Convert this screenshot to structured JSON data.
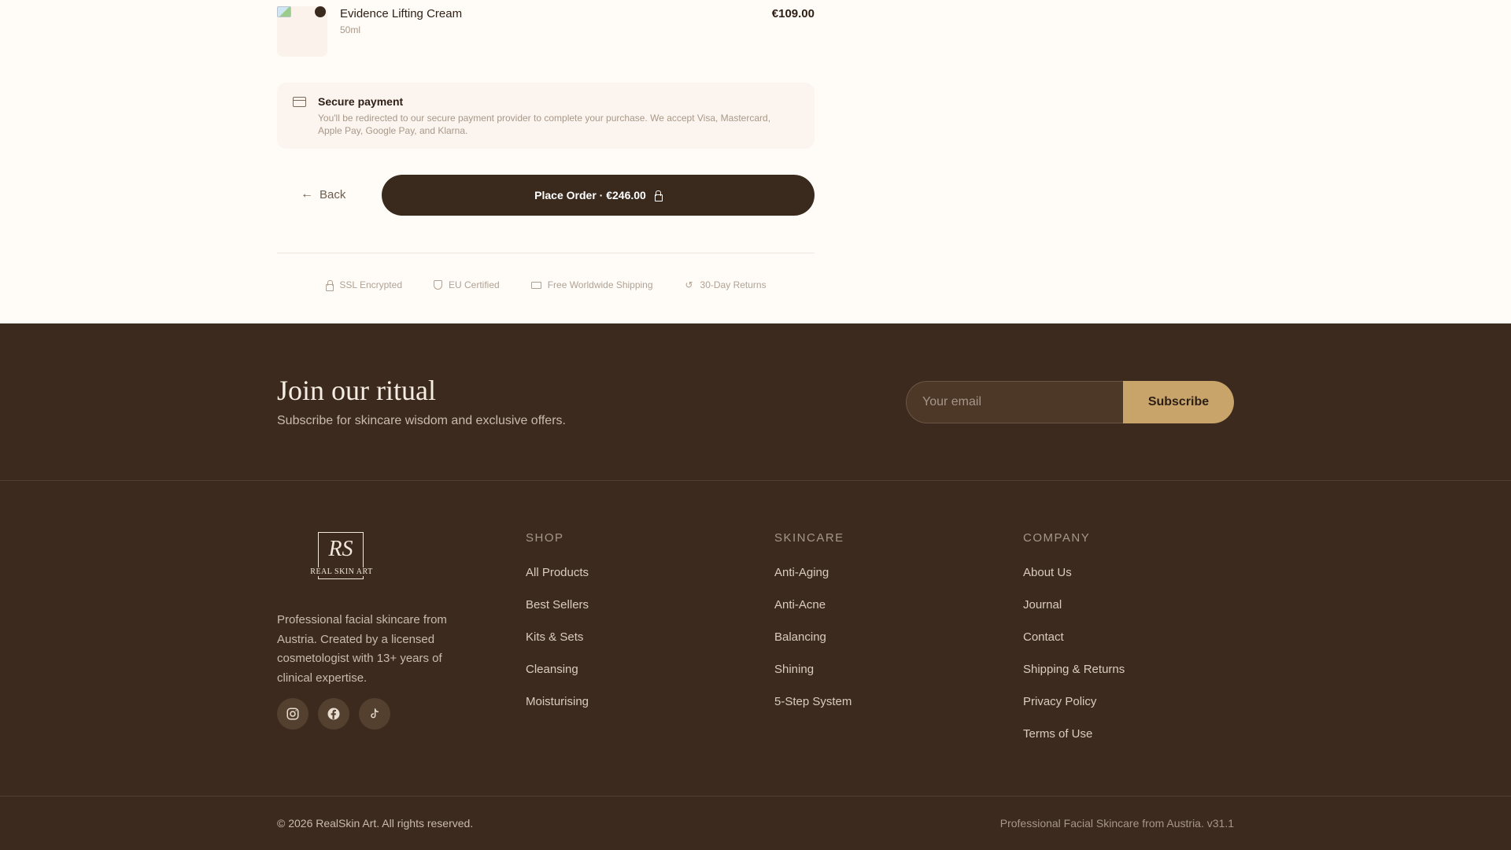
{
  "order_item": {
    "name": "Evidence Lifting Cream",
    "size": "50ml",
    "price": "€109.00"
  },
  "payment": {
    "title": "Secure payment",
    "text": "You'll be redirected to our secure payment provider to complete your purchase. We accept Visa, Mastercard, Apple Pay, Google Pay, and Klarna."
  },
  "actions": {
    "back_label": "Back",
    "place_order_label": "Place Order · €246.00"
  },
  "trust": [
    {
      "label": "SSL Encrypted",
      "icon": "lock-icon"
    },
    {
      "label": "EU Certified",
      "icon": "shield-icon"
    },
    {
      "label": "Free Worldwide Shipping",
      "icon": "truck-icon"
    },
    {
      "label": "30-Day Returns",
      "icon": "return-icon"
    }
  ],
  "newsletter": {
    "title": "Join our ritual",
    "subtitle": "Subscribe for skincare wisdom and exclusive offers.",
    "placeholder": "Your email",
    "button": "Subscribe"
  },
  "brand": {
    "monogram": "RS",
    "logo_text": "REAL SKIN ART",
    "description": "Professional facial skincare from Austria. Created by a licensed cosmetologist with 13+ years of clinical expertise.",
    "social": [
      "instagram-icon",
      "facebook-icon",
      "tiktok-icon"
    ]
  },
  "columns": {
    "shop": {
      "title": "SHOP",
      "links": [
        "All Products",
        "Best Sellers",
        "Kits & Sets",
        "Cleansing",
        "Moisturising"
      ]
    },
    "skincare": {
      "title": "SKINCARE",
      "links": [
        "Anti-Aging",
        "Anti-Acne",
        "Balancing",
        "Shining",
        "5-Step System"
      ]
    },
    "company": {
      "title": "COMPANY",
      "links": [
        "About Us",
        "Journal",
        "Contact",
        "Shipping & Returns",
        "Privacy Policy",
        "Terms of Use"
      ]
    }
  },
  "bottom": {
    "copyright": "© 2026 RealSkin Art. All rights reserved.",
    "tagline": "Professional Facial Skincare from Austria. v31.1"
  },
  "colors": {
    "background": "#fffbf6",
    "dark_brown": "#3c2a1e",
    "gold": "#c8a46a"
  }
}
